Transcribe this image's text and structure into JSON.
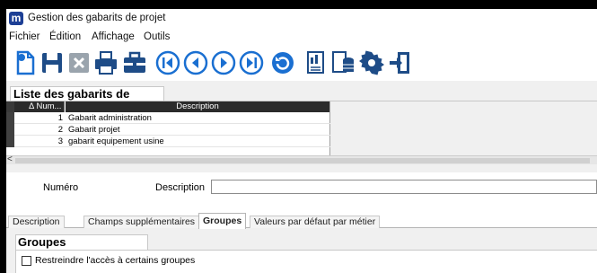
{
  "window": {
    "title": "Gestion des gabarits de projet"
  },
  "menu": [
    "Fichier",
    "Édition",
    "Affichage",
    "Outils"
  ],
  "toolbar": [
    {
      "name": "new-document-icon",
      "color": "#1a6fd1"
    },
    {
      "name": "save-icon",
      "color": "#1e4c87"
    },
    {
      "name": "delete-icon",
      "color": "#9aa4ad"
    },
    {
      "name": "print-icon",
      "color": "#1e4c87"
    },
    {
      "name": "toolbox-icon",
      "color": "#1e4c87"
    },
    {
      "name": "first-record-icon",
      "color": "#1a6fd1"
    },
    {
      "name": "previous-record-icon",
      "color": "#1a6fd1"
    },
    {
      "name": "next-record-icon",
      "color": "#1a6fd1"
    },
    {
      "name": "last-record-icon",
      "color": "#1a6fd1"
    },
    {
      "name": "refresh-icon",
      "color": "#1a6fd1"
    },
    {
      "name": "report-icon",
      "color": "#1e4c87"
    },
    {
      "name": "database-icon",
      "color": "#1e4c87"
    },
    {
      "name": "settings-gear-icon",
      "color": "#1e4c87"
    },
    {
      "name": "exit-icon",
      "color": "#1e4c87"
    }
  ],
  "list": {
    "tab_label": "Liste des gabarits de projet",
    "columns": [
      "Δ Num...",
      "Description"
    ],
    "rows": [
      {
        "num": "1",
        "description": "Gabarit administration"
      },
      {
        "num": "2",
        "description": "Gabarit projet"
      },
      {
        "num": "3",
        "description": "gabarit equipement usine"
      }
    ],
    "scroll_left": "<"
  },
  "form": {
    "numero_label": "Numéro",
    "description_label": "Description",
    "description_value": ""
  },
  "tabs": [
    {
      "label": "Description",
      "active": false
    },
    {
      "label": "Champs supplémentaires",
      "active": false
    },
    {
      "label": "Groupes",
      "active": true
    },
    {
      "label": "Valeurs par défaut par métier",
      "active": false
    }
  ],
  "groupes": {
    "title": "Groupes",
    "restrict_label": "Restreindre l'accès à certains groupes",
    "restrict_checked": false
  }
}
